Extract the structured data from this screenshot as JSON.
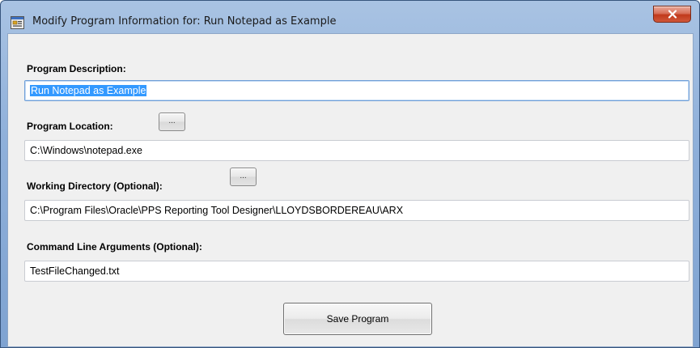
{
  "window": {
    "title": "Modify Program Information for: Run Notepad as Example"
  },
  "form": {
    "description_label": "Program Description:",
    "description_value": "Run Notepad as Example",
    "location_label": "Program Location:",
    "location_value": "C:\\Windows\\notepad.exe",
    "working_dir_label": "Working Directory (Optional):",
    "working_dir_value": "C:\\Program Files\\Oracle\\PPS Reporting Tool Designer\\LLOYDSBORDEREAU\\ARX",
    "args_label": "Command Line Arguments (Optional):",
    "args_value": "TestFileChanged.txt",
    "browse_label": "...",
    "save_label": "Save Program"
  },
  "colors": {
    "titlebar": "#8fb0da",
    "close_button": "#c1391b",
    "selection": "#3399ff",
    "client_background": "#f0f0f0"
  },
  "icons": {
    "app": "program-window-icon",
    "close": "close-icon"
  }
}
